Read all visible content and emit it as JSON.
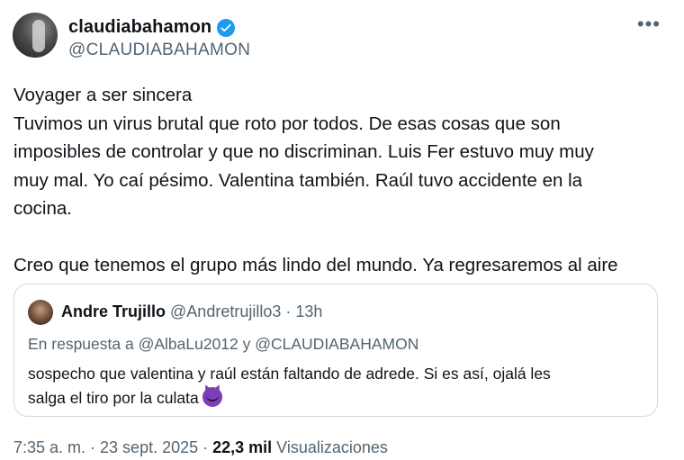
{
  "post": {
    "display_name": "claudiabahamon",
    "handle": "@CLAUDIABAHAMON",
    "more_icon": "more-horizontal-icon",
    "lines": [
      "Voyager a ser sincera",
      "Tuvimos un virus brutal que roto por todos. De esas cosas que son",
      "imposibles de controlar y que no discriminan. Luis Fer estuvo muy muy",
      "muy mal. Yo caí pésimo. Valentina también. Raúl tuvo accidente en la",
      "cocina."
    ],
    "line_last": "Creo que tenemos el grupo más lindo del mundo. Ya regresaremos al aire"
  },
  "quote": {
    "display_name": "Andre Trujillo",
    "meta": "@Andretrujillo3 · 13h",
    "reply_to": "En respuesta a @AlbaLu2012 y @CLAUDIABAHAMON",
    "line1": "sospecho que valentina y raúl están faltando de adrede. Si es así, ojalá les",
    "line2": "salga el tiro por la culata",
    "emoji_icon": "smiling-devil-icon"
  },
  "footer": {
    "time": "7:35 a. m. · 23 sept. 2025 · ",
    "views_count": "22,3 mil",
    "views_label": " Visualizaciones"
  }
}
